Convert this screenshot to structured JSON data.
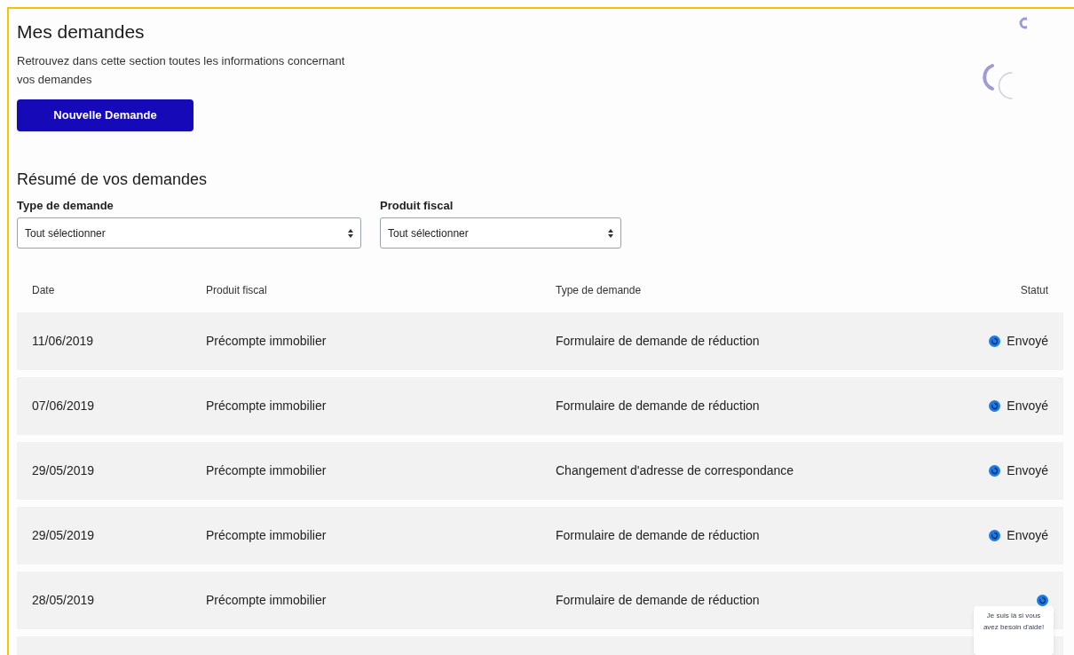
{
  "page": {
    "title": "Mes demandes",
    "description": "Retrouvez dans cette section toutes les informations concernant vos demandes",
    "new_request_button": "Nouvelle Demande"
  },
  "summary": {
    "title": "Résumé de vos demandes",
    "filters": [
      {
        "label": "Type de demande",
        "value": "Tout sélectionner"
      },
      {
        "label": "Produit fiscal",
        "value": "Tout sélectionner"
      }
    ]
  },
  "table": {
    "columns": [
      "Date",
      "Produit fiscal",
      "Type de demande",
      "Statut"
    ],
    "rows": [
      {
        "date": "11/06/2019",
        "product": "Précompte immobilier",
        "type": "Formulaire de demande de réduction",
        "status": "Envoyé"
      },
      {
        "date": "07/06/2019",
        "product": "Précompte immobilier",
        "type": "Formulaire de demande de réduction",
        "status": "Envoyé"
      },
      {
        "date": "29/05/2019",
        "product": "Précompte immobilier",
        "type": "Changement d'adresse de correspondance",
        "status": "Envoyé"
      },
      {
        "date": "29/05/2019",
        "product": "Précompte immobilier",
        "type": "Formulaire de demande de réduction",
        "status": "Envoyé"
      },
      {
        "date": "28/05/2019",
        "product": "Précompte immobilier",
        "type": "Formulaire de demande de réduction"
      }
    ]
  },
  "help_bubble": {
    "text": "Je suis là si vous avez besoin d'aide!"
  }
}
